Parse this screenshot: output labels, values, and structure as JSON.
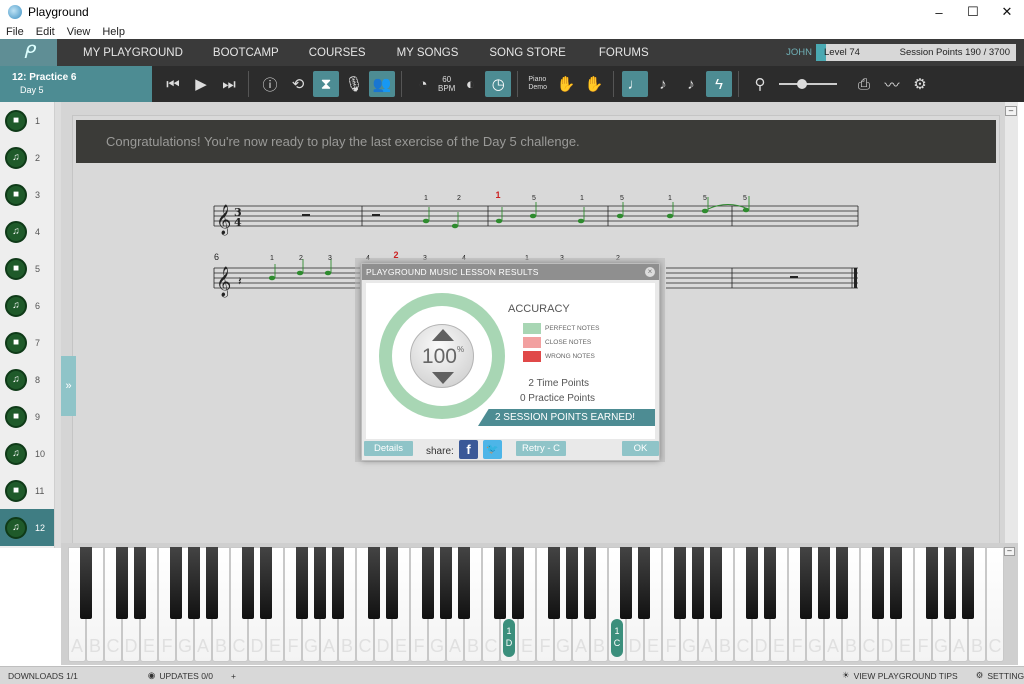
{
  "window": {
    "title": "Playground",
    "controls": [
      "–",
      "☐",
      "✕"
    ]
  },
  "menu": [
    "File",
    "Edit",
    "View",
    "Help"
  ],
  "nav": {
    "items": [
      "MY PLAYGROUND",
      "BOOTCAMP",
      "COURSES",
      "MY SONGS",
      "SONG STORE",
      "FORUMS"
    ],
    "user": "JOHN",
    "level": "Level 74",
    "session_points": "Session Points 190 / 3700",
    "level_progress": 0.05
  },
  "lesson": {
    "title": "12: Practice 6",
    "subtitle": "Day 5"
  },
  "toolbar": {
    "bpm_value": "60",
    "bpm_label": "BPM",
    "piano_label": "Piano",
    "demo_label": "Demo"
  },
  "exercises": [
    {
      "num": "1",
      "icon": "video-icon"
    },
    {
      "num": "2",
      "icon": "music-note-icon"
    },
    {
      "num": "3",
      "icon": "video-icon"
    },
    {
      "num": "4",
      "icon": "music-note-icon"
    },
    {
      "num": "5",
      "icon": "video-icon"
    },
    {
      "num": "6",
      "icon": "music-note-icon"
    },
    {
      "num": "7",
      "icon": "video-icon"
    },
    {
      "num": "8",
      "icon": "music-note-icon"
    },
    {
      "num": "9",
      "icon": "video-icon"
    },
    {
      "num": "10",
      "icon": "music-note-icon"
    },
    {
      "num": "11",
      "icon": "video-icon"
    },
    {
      "num": "12",
      "icon": "music-note-icon",
      "selected": true
    }
  ],
  "banner": "Congratulations! You're now ready to play the last exercise of the Day 5 challenge.",
  "score": {
    "measure_number": "6",
    "time_signature_top": "3",
    "time_signature_bottom": "4",
    "fingering": [
      "1",
      "2",
      "1",
      "5",
      "1",
      "5",
      "1",
      "5",
      "5",
      "1",
      "2",
      "3",
      "4",
      "2",
      "3",
      "4",
      "1",
      "3",
      "2"
    ],
    "note_color": "#2e8b2e",
    "highlight_color": "#cc2222"
  },
  "results": {
    "header": "PLAYGROUND MUSIC LESSON RESULTS",
    "percent": "100",
    "percent_sign": "%",
    "accuracy_label": "ACCURACY",
    "legend": [
      {
        "label": "PERFECT NOTES",
        "color": "#a8d6b4"
      },
      {
        "label": "CLOSE NOTES",
        "color": "#f2a0a0"
      },
      {
        "label": "WRONG NOTES",
        "color": "#e04848"
      }
    ],
    "time_points": "2 Time Points",
    "practice_points": "0 Practice Points",
    "earned": "2 SESSION POINTS EARNED!",
    "buttons": {
      "details": "Details",
      "share": "share:",
      "retry": "Retry - C",
      "ok": "OK"
    },
    "accuracy_value": 1.0
  },
  "keyboard": {
    "labels": [
      "A",
      "B",
      "C",
      "D",
      "E",
      "F",
      "G",
      "A",
      "B",
      "C",
      "D",
      "E",
      "F",
      "G",
      "A",
      "B",
      "C",
      "D",
      "E",
      "F",
      "G",
      "A",
      "B",
      "C",
      "D",
      "E",
      "F",
      "G",
      "A",
      "B",
      "C",
      "D",
      "E",
      "F",
      "G",
      "A",
      "B",
      "C",
      "D",
      "E",
      "F",
      "G",
      "A",
      "B",
      "C",
      "D",
      "E",
      "F",
      "G",
      "A",
      "B",
      "C"
    ],
    "markers": [
      {
        "note": "D",
        "finger": "1"
      },
      {
        "note": "C",
        "finger": "1"
      }
    ]
  },
  "status": {
    "downloads": "DOWNLOADS 1/1",
    "updates": "UPDATES 0/0",
    "tips": "VIEW PLAYGROUND TIPS",
    "settings": "SETTINGS"
  }
}
